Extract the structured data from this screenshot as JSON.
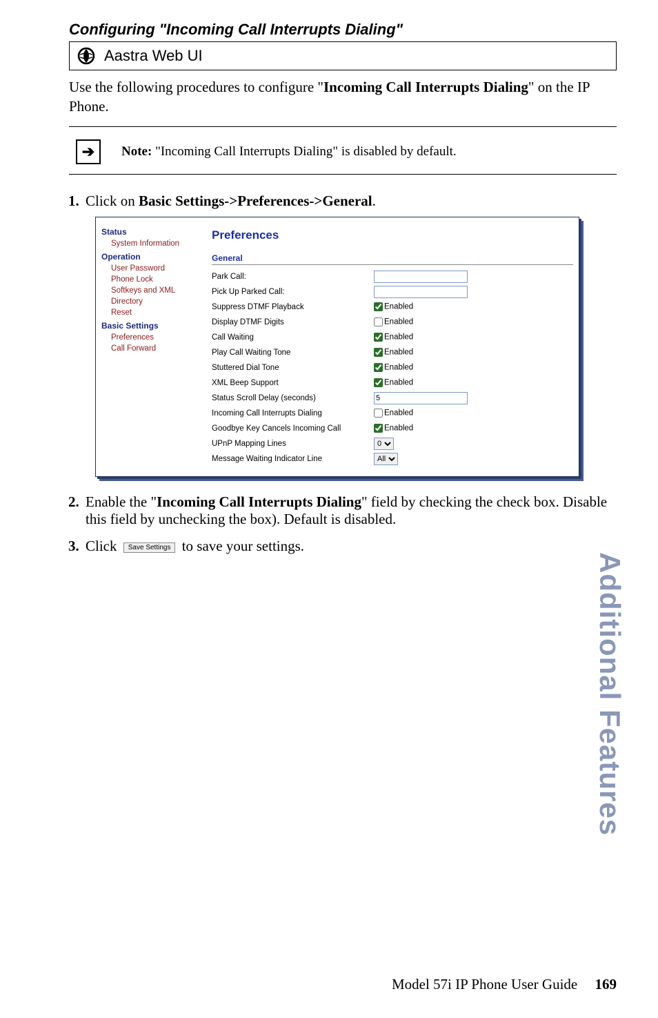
{
  "section_title": "Configuring \"Incoming Call Interrupts Dialing\"",
  "ui_bar_label": "Aastra Web UI",
  "intro_prefix": "Use the following procedures to configure \"",
  "intro_bold": "Incoming Call Interrupts Dialing",
  "intro_suffix": "\" on the IP Phone.",
  "note_label": "Note:",
  "note_body": " \"Incoming Call Interrupts Dialing\" is disabled by default.",
  "step1_prefix": "Click on ",
  "step1_bold": "Basic Settings->Preferences->General",
  "step1_suffix": ".",
  "step2_prefix": "Enable the \"",
  "step2_bold": "Incoming Call Interrupts Dialing",
  "step2_suffix": "\" field by checking the check box. Disable this field by unchecking the box). Default is disabled.",
  "step3_prefix": "Click ",
  "step3_button": "Save Settings",
  "step3_suffix": " to save your settings.",
  "screenshot": {
    "nav": {
      "status": "Status",
      "system_info": "System Information",
      "operation": "Operation",
      "user_password": "User Password",
      "phone_lock": "Phone Lock",
      "softkeys_xml": "Softkeys and XML",
      "directory": "Directory",
      "reset": "Reset",
      "basic_settings": "Basic Settings",
      "preferences": "Preferences",
      "call_forward": "Call Forward"
    },
    "main_title": "Preferences",
    "group_general": "General",
    "rows": {
      "park_call": "Park Call:",
      "pick_up_parked": "Pick Up Parked Call:",
      "suppress_dtmf": "Suppress DTMF Playback",
      "display_dtmf": "Display DTMF Digits",
      "call_waiting": "Call Waiting",
      "play_cw_tone": "Play Call Waiting Tone",
      "stuttered_dial": "Stuttered Dial Tone",
      "xml_beep": "XML Beep Support",
      "status_scroll": "Status Scroll Delay (seconds)",
      "incoming_interrupts": "Incoming Call Interrupts Dialing",
      "goodbye_cancel": "Goodbye Key Cancels Incoming Call",
      "upnp": "UPnP Mapping Lines",
      "mwi_line": "Message Waiting Indicator Line"
    },
    "enabled_label": "Enabled",
    "status_scroll_value": "5",
    "upnp_value": "0",
    "mwi_value": "All"
  },
  "side_tab": "Additional Features",
  "footer_text": "Model 57i IP Phone User Guide",
  "page_number": "169"
}
